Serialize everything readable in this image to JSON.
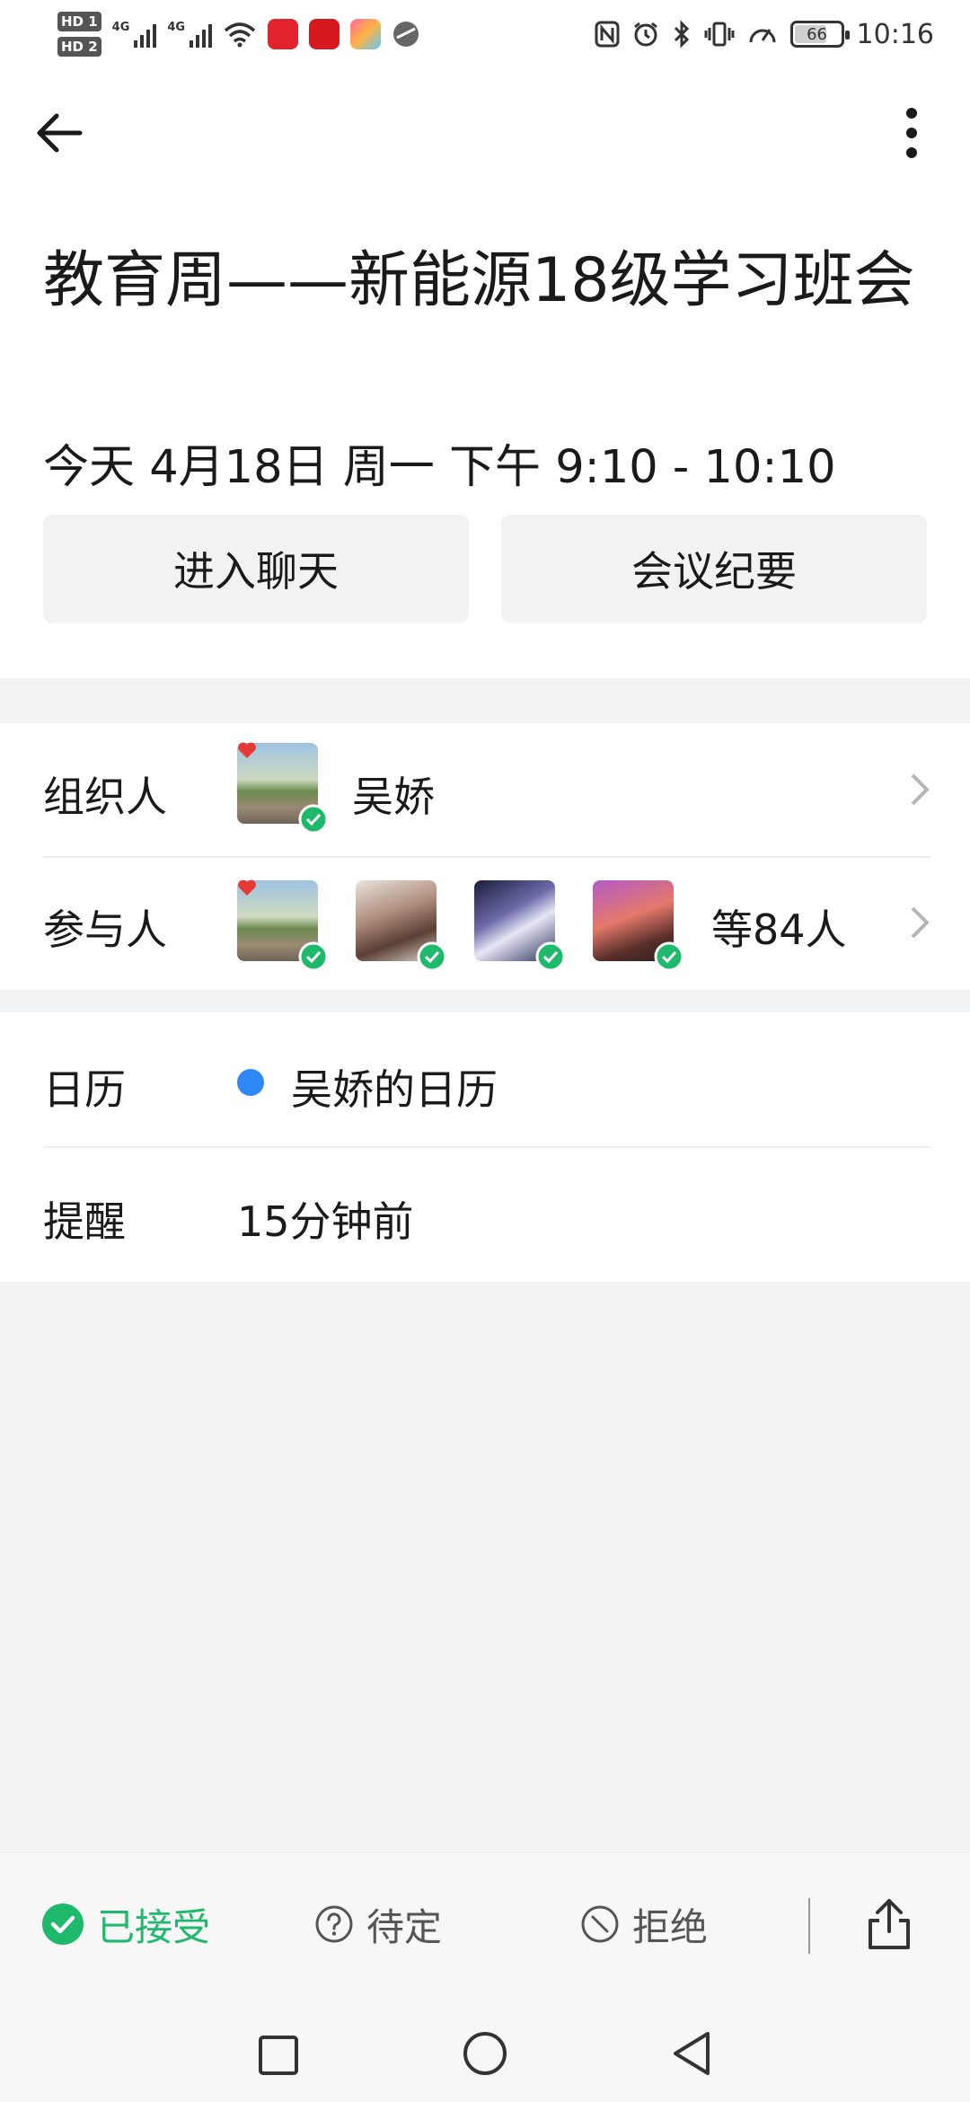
{
  "status_bar": {
    "network_labels": [
      "HD 1",
      "HD 2"
    ],
    "signal_1": "4G",
    "signal_2": "4G",
    "battery_level": "66",
    "time": "10:16",
    "colors": {
      "app1": "#e2222d",
      "app2": "#e2222d",
      "app3": "#f5a623"
    }
  },
  "header": {
    "back_icon": "arrow-left-icon",
    "more_icon": "more-vertical-icon"
  },
  "event": {
    "title": "教育周——新能源18级学习班会",
    "datetime": "今天 4月18日 周一 下午 9:10 - 10:10",
    "enter_chat_label": "进入聊天",
    "minutes_label": "会议纪要"
  },
  "organizer": {
    "label": "组织人",
    "name": "吴娇"
  },
  "participants": {
    "label": "参与人",
    "count_label": "等84人",
    "avatars": [
      "avatar-1",
      "avatar-2",
      "avatar-3",
      "avatar-4"
    ]
  },
  "calendar": {
    "label": "日历",
    "value": "吴娇的日历",
    "dot_color": "#3088f4"
  },
  "reminder": {
    "label": "提醒",
    "value": "15分钟前"
  },
  "rsvp": {
    "accepted_label": "已接受",
    "pending_label": "待定",
    "declined_label": "拒绝",
    "accent": "#1fb96b"
  }
}
